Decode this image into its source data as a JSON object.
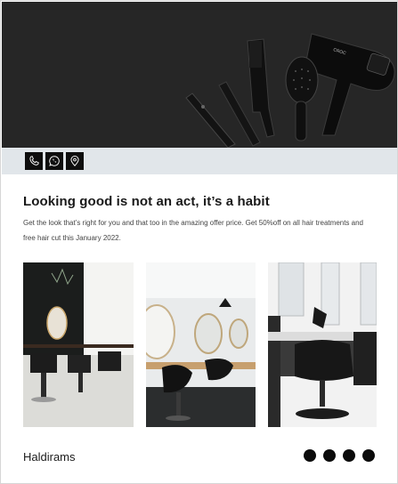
{
  "hero": {
    "image": "hair-styling-tools-photo"
  },
  "contact_icons": [
    "phone-icon",
    "whatsapp-icon",
    "location-pin-icon"
  ],
  "promo": {
    "headline": "Looking good is not an act, it’s a habit",
    "description": "Get the look that’s right for you and that too in the amazing offer price. Get 50%off on all hair treatments and free hair cut this January 2022."
  },
  "gallery": [
    "salon-interior-photo-1",
    "salon-interior-photo-2",
    "salon-interior-photo-3"
  ],
  "footer": {
    "brand": "Haldirams",
    "carousel_dots": 4
  },
  "colors": {
    "hero_bg": "#262626",
    "contact_bar_bg": "#e1e6ea",
    "accent": "#0e0e0e"
  }
}
